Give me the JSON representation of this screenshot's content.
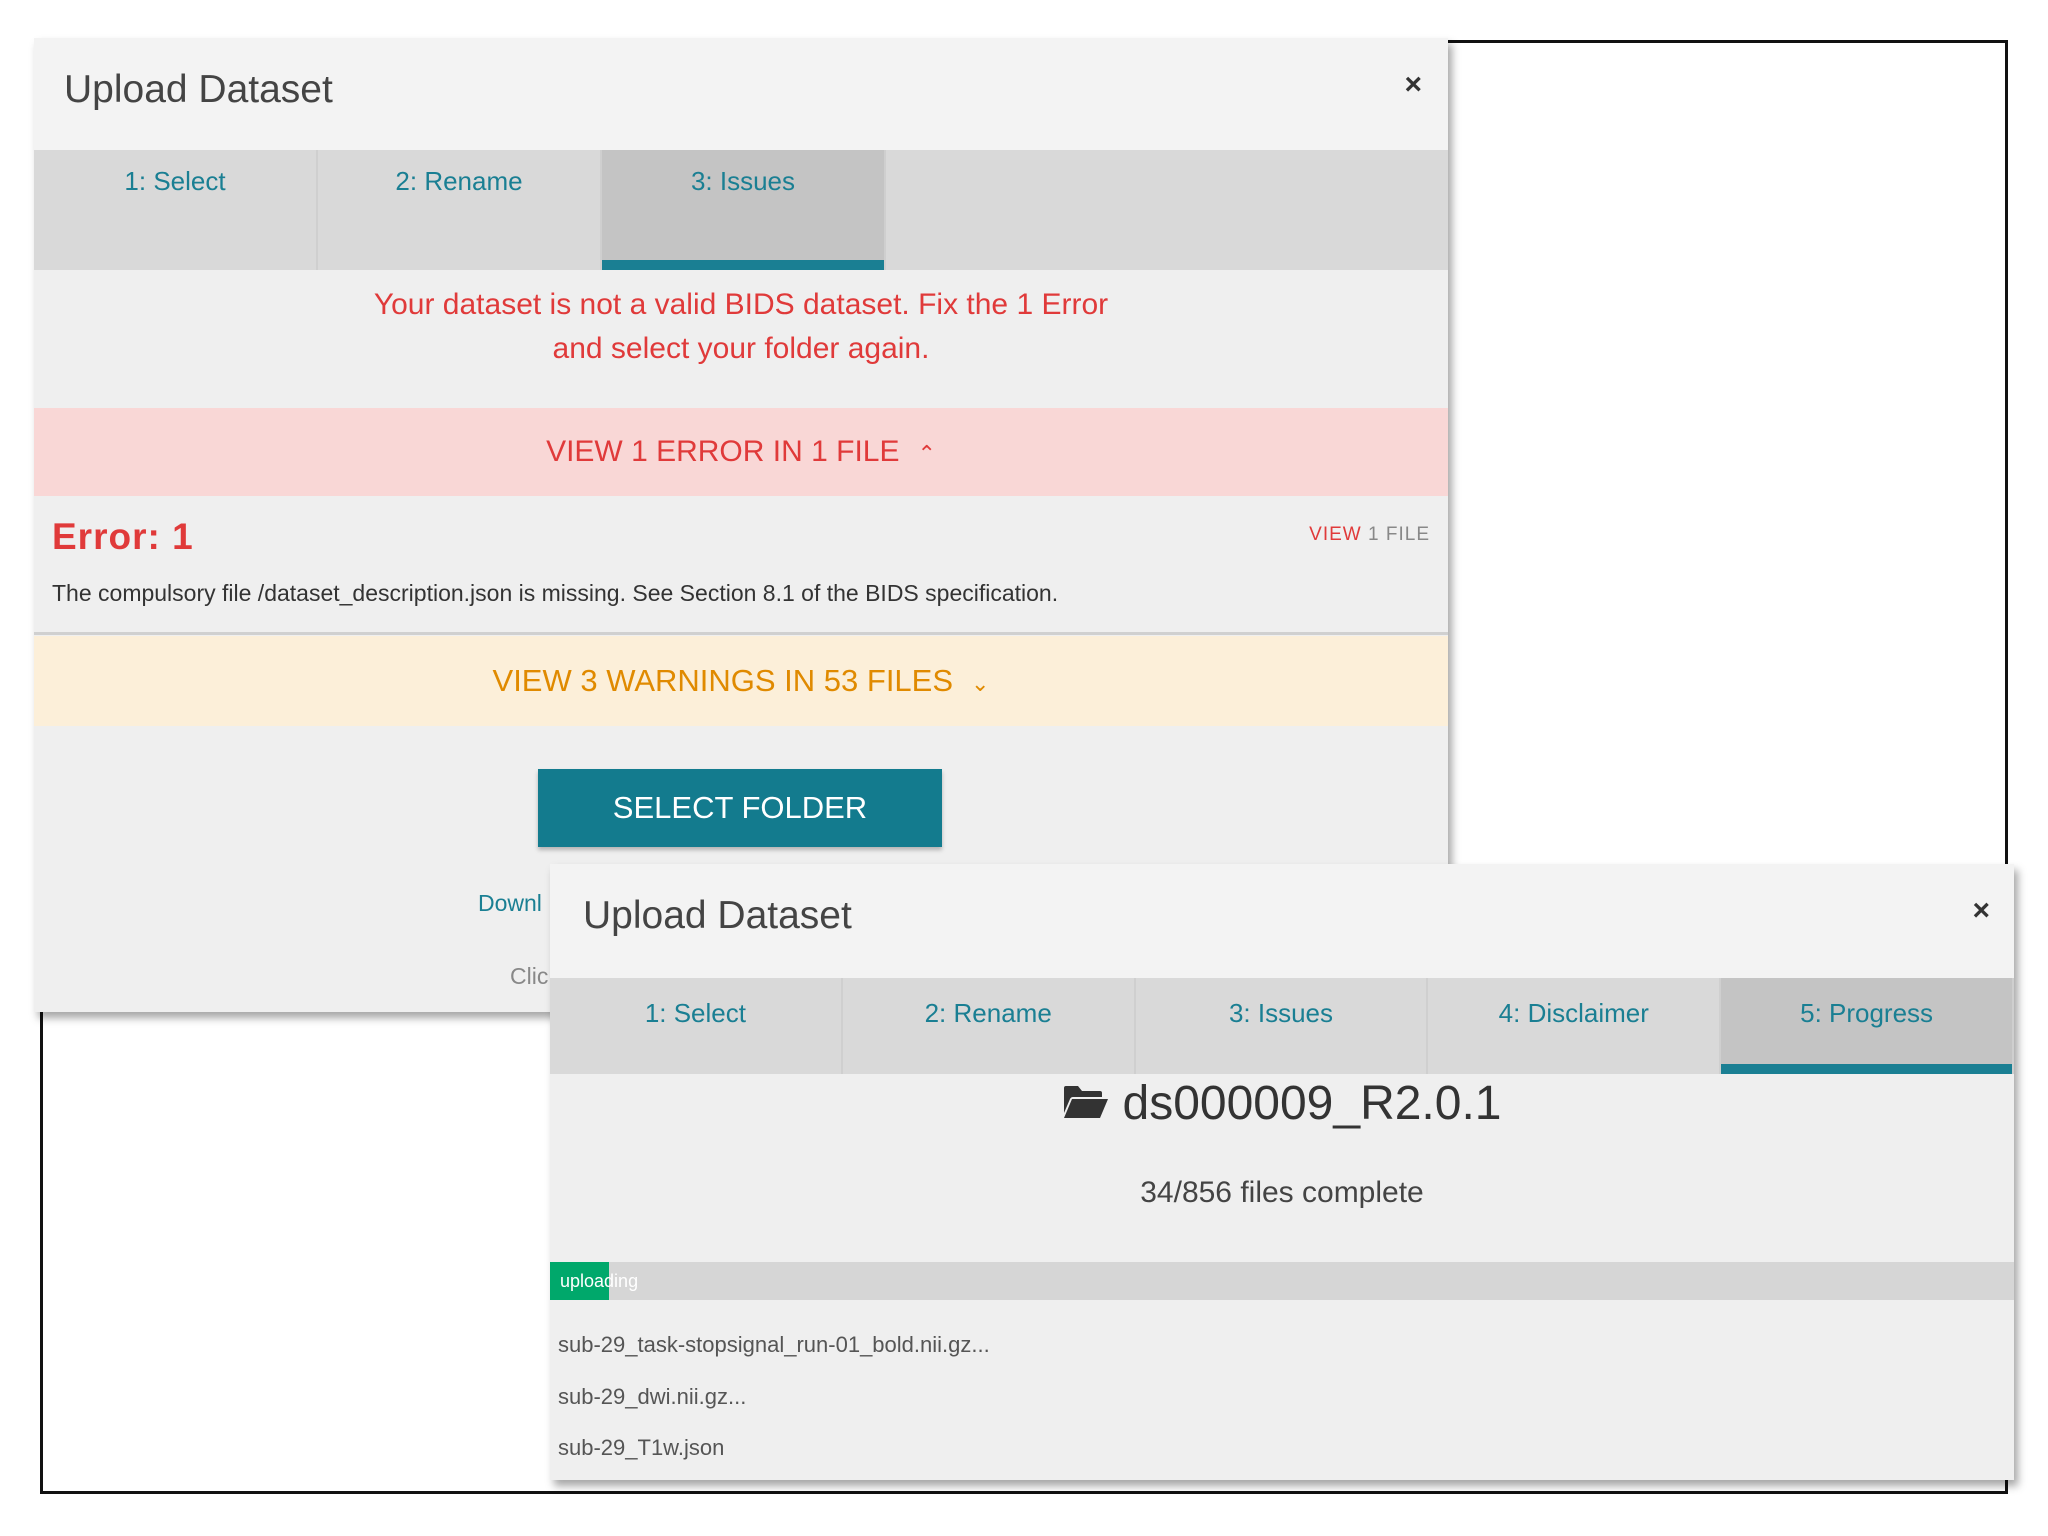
{
  "modal1": {
    "title": "Upload Dataset",
    "close": "×",
    "tabs": [
      {
        "label": "1: Select"
      },
      {
        "label": "2: Rename"
      },
      {
        "label": "3: Issues"
      }
    ],
    "error_message_line1": "Your dataset is not a valid BIDS dataset. Fix the 1 Error",
    "error_message_line2": "and select your folder again.",
    "error_bar_label": "VIEW 1 ERROR IN 1 FILE",
    "error_title": "Error: 1",
    "view_file_prefix": "VIEW",
    "view_file_count": "1",
    "view_file_suffix": "FILE",
    "error_description": "The compulsory file /dataset_description.json is missing. See Section 8.1 of the BIDS specification.",
    "warning_bar_label": "VIEW 3 WARNINGS IN 53 FILES",
    "select_folder_label": "SELECT FOLDER",
    "download_link_partial": "Downl",
    "click_text_partial": "Clic"
  },
  "modal2": {
    "title": "Upload Dataset",
    "close": "×",
    "tabs": [
      {
        "label": "1: Select"
      },
      {
        "label": "2: Rename"
      },
      {
        "label": "3: Issues"
      },
      {
        "label": "4: Disclaimer"
      },
      {
        "label": "5: Progress"
      }
    ],
    "dataset_name": "ds000009_R2.0.1",
    "files_complete": "34/856 files complete",
    "progress_fraction": 0.04,
    "progress_label": "uploading",
    "files": [
      "sub-29_task-stopsignal_run-01_bold.nii.gz...",
      "sub-29_dwi.nii.gz...",
      "sub-29_T1w.json"
    ]
  },
  "colors": {
    "accent_teal": "#1a7f93",
    "error_red": "#e03a3a",
    "warning_orange": "#e08a00",
    "progress_green": "#00a86b"
  }
}
